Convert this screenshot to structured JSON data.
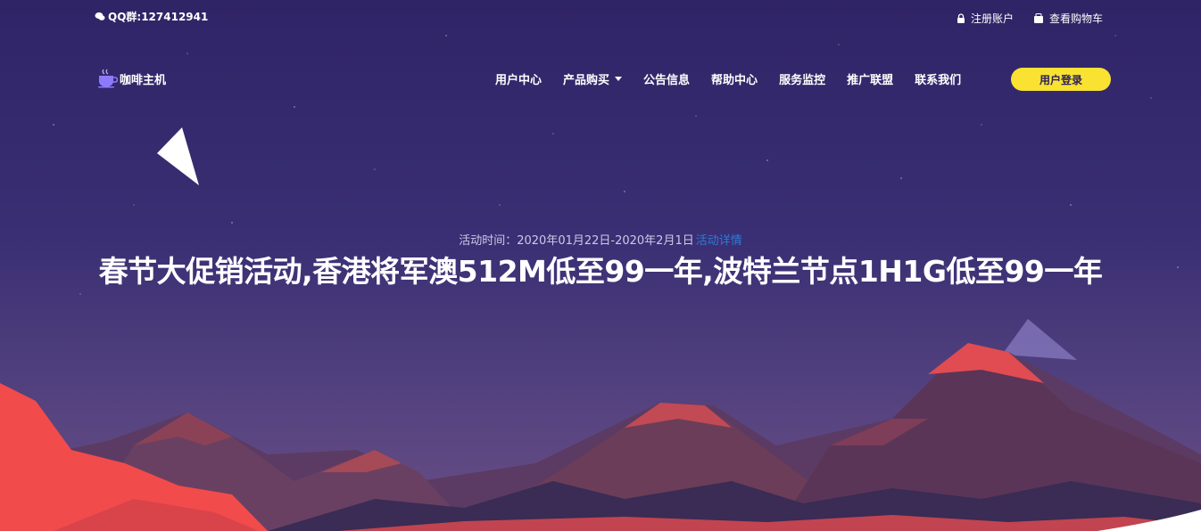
{
  "topbar": {
    "qq": "QQ群:127412941",
    "links": [
      {
        "icon": "lock-icon",
        "label": "注册账户"
      },
      {
        "icon": "cart-icon",
        "label": "查看购物车"
      }
    ]
  },
  "brand": {
    "name": "咖啡主机",
    "icon": "coffee-cup-icon"
  },
  "nav": {
    "items": [
      {
        "label": "用户中心"
      },
      {
        "label": "产品购买",
        "dropdown": true
      },
      {
        "label": "公告信息"
      },
      {
        "label": "帮助中心"
      },
      {
        "label": "服务监控"
      },
      {
        "label": "推广联盟"
      },
      {
        "label": "联系我们"
      }
    ],
    "login_label": "用户登录"
  },
  "hero": {
    "date_prefix": "活动时间：2020年01月22日-2020年2月1日",
    "date_link": "活动详情",
    "headline": "春节大促销活动,香港将军澳512M低至99一年,波特兰节点1H1G低至99一年"
  },
  "colors": {
    "background_top": "#2f2466",
    "background_bottom": "#6a4f86",
    "accent_button": "#f9e232",
    "mountain_red": "#f24b4b",
    "mountain_dark": "#3a2c54",
    "link_blue": "#2f7bd6"
  }
}
